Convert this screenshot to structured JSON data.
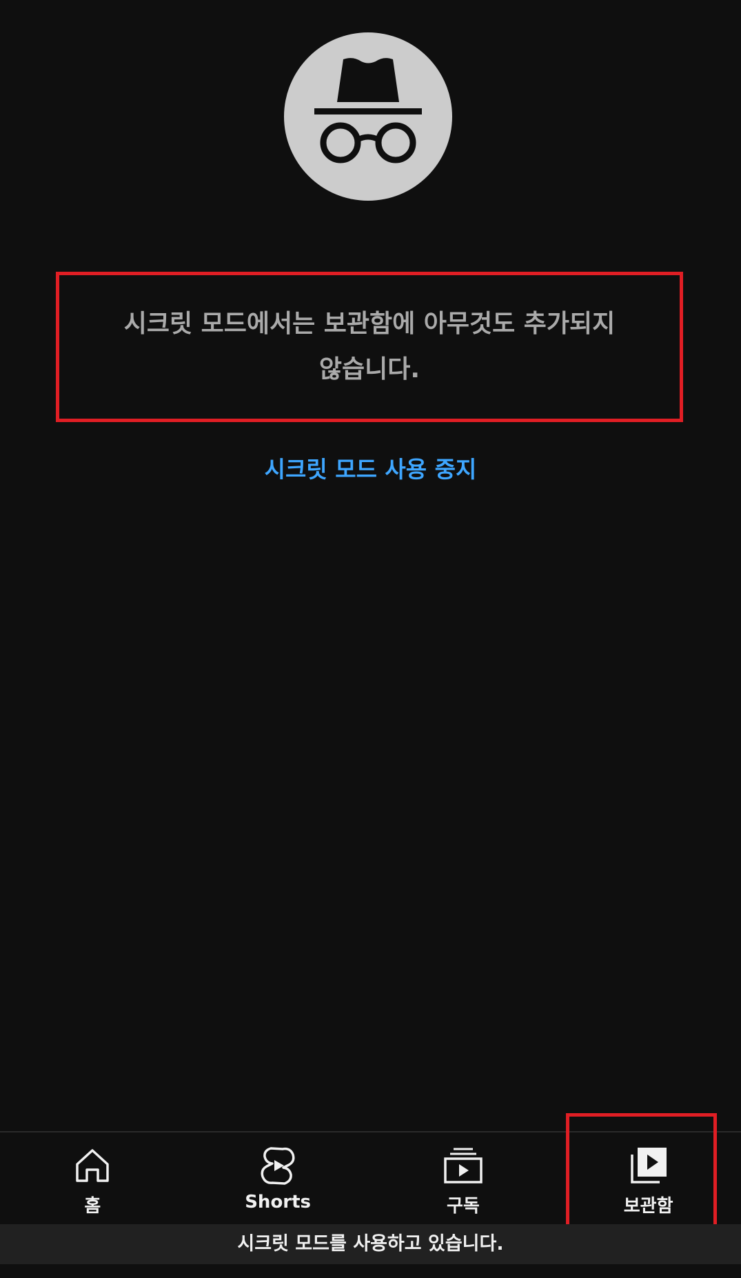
{
  "incognito": {
    "icon": "incognito-icon",
    "message": "시크릿 모드에서는 보관함에 아무것도 추가되지 않습니다.",
    "stop_link": "시크릿 모드 사용 중지",
    "banner": "시크릿 모드를 사용하고 있습니다."
  },
  "bottom_nav": {
    "items": [
      {
        "label": "홈",
        "icon": "home-icon"
      },
      {
        "label": "Shorts",
        "icon": "shorts-icon"
      },
      {
        "label": "구독",
        "icon": "subscriptions-icon"
      },
      {
        "label": "보관함",
        "icon": "library-icon",
        "selected": true
      }
    ]
  },
  "colors": {
    "background": "#0f0f0f",
    "link": "#3ea6ff",
    "highlight": "#e01e24",
    "avatar_bg": "#cccccc"
  }
}
